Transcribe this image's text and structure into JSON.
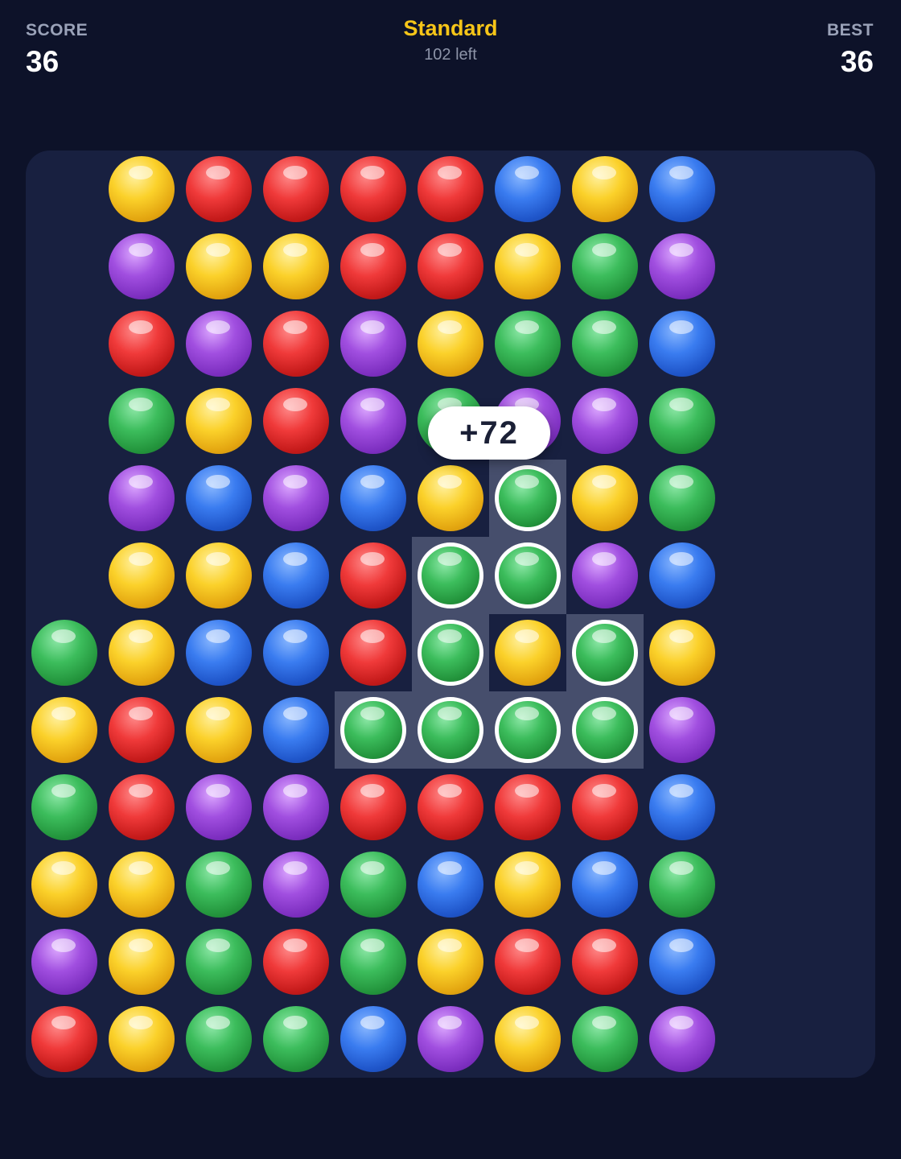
{
  "header": {
    "score_label": "SCORE",
    "score_value": "36",
    "mode_title": "Standard",
    "remaining": "102 left",
    "best_label": "BEST",
    "best_value": "36"
  },
  "popup": {
    "text": "+72"
  },
  "board": {
    "rows": [
      [
        null,
        "yellow",
        "red",
        "red",
        "red",
        "red",
        "blue",
        "yellow",
        "blue"
      ],
      [
        null,
        "purple",
        "yellow",
        "yellow",
        "red",
        "red",
        "yellow",
        "green",
        "purple"
      ],
      [
        null,
        "red",
        "purple",
        "red",
        "purple",
        "yellow",
        "green",
        "green",
        "blue"
      ],
      [
        null,
        "green",
        "yellow",
        "red",
        "purple",
        "green",
        "purple",
        "purple",
        "green"
      ],
      [
        null,
        "purple",
        "blue",
        "purple",
        "blue",
        "yellow",
        "green",
        "yellow",
        "green"
      ],
      [
        null,
        "yellow",
        "yellow",
        "blue",
        "red",
        "green",
        "green",
        "purple",
        "blue"
      ],
      [
        "green",
        "yellow",
        "blue",
        "blue",
        "red",
        "green",
        "yellow",
        "green",
        "yellow"
      ],
      [
        "yellow",
        "red",
        "yellow",
        "blue",
        "green",
        "green",
        "green",
        "green",
        "purple"
      ],
      [
        "green",
        "red",
        "purple",
        "purple",
        "red",
        "red",
        "red",
        "red",
        "blue"
      ],
      [
        "yellow",
        "yellow",
        "green",
        "purple",
        "green",
        "blue",
        "yellow",
        "blue",
        "green"
      ],
      [
        "purple",
        "yellow",
        "green",
        "red",
        "green",
        "yellow",
        "red",
        "red",
        "blue"
      ],
      [
        "red",
        "yellow",
        "green",
        "green",
        "blue",
        "purple",
        "yellow",
        "green",
        "purple"
      ]
    ],
    "selected": [
      [
        4,
        6
      ],
      [
        5,
        5
      ],
      [
        5,
        6
      ],
      [
        6,
        5
      ],
      [
        6,
        7
      ],
      [
        7,
        4
      ],
      [
        7,
        5
      ],
      [
        7,
        6
      ],
      [
        7,
        7
      ]
    ]
  }
}
